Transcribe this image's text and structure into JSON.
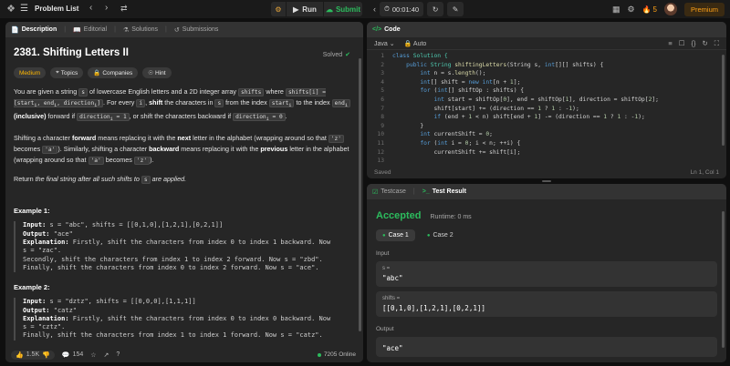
{
  "topbar": {
    "logo": "logo-icon",
    "problem_list_label": "Problem List",
    "run_label": "Run",
    "submit_label": "Submit",
    "timer": "00:01:40",
    "streak": "5",
    "premium_label": "Premium"
  },
  "description": {
    "tabs": [
      {
        "label": "Description"
      },
      {
        "label": "Editorial"
      },
      {
        "label": "Solutions"
      },
      {
        "label": "Submissions"
      }
    ],
    "title": "2381. Shifting Letters II",
    "solved": "Solved",
    "badges": {
      "difficulty": "Medium",
      "topics": "Topics",
      "companies": "Companies",
      "hint": "Hint"
    },
    "p1": {
      "a": "You are given a string ",
      "c1": "s",
      "b": " of lowercase English letters and a 2D integer array ",
      "c2": "shifts",
      "c": " where ",
      "c3": "shifts[i] = [start",
      "c3s": "i",
      "c3b": ", end",
      "c3c": ", direction",
      "c3d": "]",
      "d": ". For every ",
      "c4": "i",
      "e": ", ",
      "shift": "shift",
      "f": " the characters in ",
      "c5": "s",
      "g": " from the index ",
      "c6": "start",
      "h": " to the index ",
      "c7": "end",
      "i": " ",
      "incl": "(inclusive)",
      "j": " forward if ",
      "c8": "direction",
      "c8b": " = 1",
      "k": ", or shift the characters backward if ",
      "c9": "direction",
      "c9b": " = 0",
      "l": "."
    },
    "p2": {
      "a": "Shifting a character ",
      "forward": "forward",
      "b": " means replacing it with the ",
      "next": "next",
      "c": " letter in the alphabet (wrapping around so that ",
      "c1": "'z'",
      "d": " becomes ",
      "c2": "'a'",
      "e": "). Similarly, shifting a character ",
      "backward": "backward",
      "f": " means replacing it with the ",
      "previous": "previous",
      "g": " letter in the alphabet (wrapping around so that ",
      "c3": "'a'",
      "h": " becomes ",
      "c4": "'z'",
      "i": ")."
    },
    "p3": {
      "a": "Return ",
      "em": "the final string after all such shifts to ",
      "c1": "s",
      "b": " are applied."
    },
    "example1": {
      "title": "Example 1:",
      "input_label": "Input:",
      "input": "s = \"abc\", shifts = [[0,1,0],[1,2,1],[0,2,1]]",
      "output_label": "Output:",
      "output": "\"ace\"",
      "explanation_label": "Explanation:",
      "explanation_1": "Firstly, shift the characters from index 0 to index 1 backward. Now",
      "explanation_2": "s = \"zac\".",
      "explanation_3": "Secondly, shift the characters from index 1 to index 2 forward. Now s = \"zbd\".",
      "explanation_4": "Finally, shift the characters from index 0 to index 2 forward. Now s = \"ace\"."
    },
    "example2": {
      "title": "Example 2:",
      "input_label": "Input:",
      "input": "s = \"dztz\", shifts = [[0,0,0],[1,1,1]]",
      "output_label": "Output:",
      "output": "\"catz\"",
      "explanation_label": "Explanation:",
      "explanation_1": "Firstly, shift the characters from index 0 to index 0 backward. Now",
      "explanation_2": "s = \"cztz\".",
      "explanation_3": "Finally, shift the characters from index 1 to index 1 forward. Now s = \"catz\"."
    },
    "footer": {
      "likes": "1.5K",
      "comments": "154",
      "online": "7205 Online"
    }
  },
  "code": {
    "tab_label": "Code",
    "language": "Java",
    "mode": "Auto",
    "status_left": "Saved",
    "status_right": "Ln 1, Col 1",
    "line_numbers": [
      "1",
      "2",
      "3",
      "4",
      "5",
      "6",
      "7",
      "8",
      "9",
      "10",
      "11",
      "12",
      "13"
    ],
    "lines": {
      "l1a": "class",
      "l1b": " Solution {",
      "l2a": "    public",
      "l2b": " String",
      "l2c": " shiftingLetters",
      "l2d": "(String s, ",
      "l2e": "int",
      "l2f": "[][] shifts) {",
      "l3a": "        int",
      "l3b": " n = s.",
      "l3c": "length",
      "l3d": "();",
      "l4a": "        int",
      "l4b": "[] shift = ",
      "l4c": "new",
      "l4d": " int",
      "l4e": "[n + ",
      "l4f": "1",
      "l4g": "];",
      "l5a": "        for",
      "l5b": " (",
      "l5c": "int",
      "l5d": "[] shiftOp : shifts) {",
      "l6a": "            int",
      "l6b": " start = shiftOp[",
      "l6c": "0",
      "l6d": "], end = shiftOp[",
      "l6e": "1",
      "l6f": "], direction = shiftOp[",
      "l6g": "2",
      "l6h": "];",
      "l7a": "            shift[start] += (direction == ",
      "l7b": "1",
      "l7c": " ? ",
      "l7d": "1",
      "l7e": " : -",
      "l7f": "1",
      "l7g": ");",
      "l8a": "            if",
      "l8b": " (end + ",
      "l8c": "1",
      "l8d": " < n) shift[end + ",
      "l8e": "1",
      "l8f": "] -= (direction == ",
      "l8g": "1",
      "l8h": " ? ",
      "l8i": "1",
      "l8j": " : -",
      "l8k": "1",
      "l8l": ");",
      "l9": "        }",
      "l10a": "        int",
      "l10b": " currentShift = ",
      "l10c": "0",
      "l10d": ";",
      "l11a": "        for",
      "l11b": " (",
      "l11c": "int",
      "l11d": " i = ",
      "l11e": "0",
      "l11f": "; i < n; ++i) {",
      "l12a": "            currentShift += shift[i];",
      "l13": ""
    }
  },
  "result": {
    "tabs": [
      {
        "label": "Testcase"
      },
      {
        "label": "Test Result"
      }
    ],
    "status": "Accepted",
    "runtime": "Runtime: 0 ms",
    "cases": [
      {
        "label": "Case 1"
      },
      {
        "label": "Case 2"
      }
    ],
    "input_label": "Input",
    "var1_name": "s =",
    "var1_value": "\"abc\"",
    "var2_name": "shifts =",
    "var2_value": "[[0,1,0],[1,2,1],[0,2,1]]",
    "output_label": "Output",
    "output_value": "\"ace\""
  },
  "colors": {
    "accent": "#ffa116",
    "success": "#2cbb5d",
    "medium": "#ffb800",
    "panel": "#262626",
    "background": "#0f0f0f"
  }
}
